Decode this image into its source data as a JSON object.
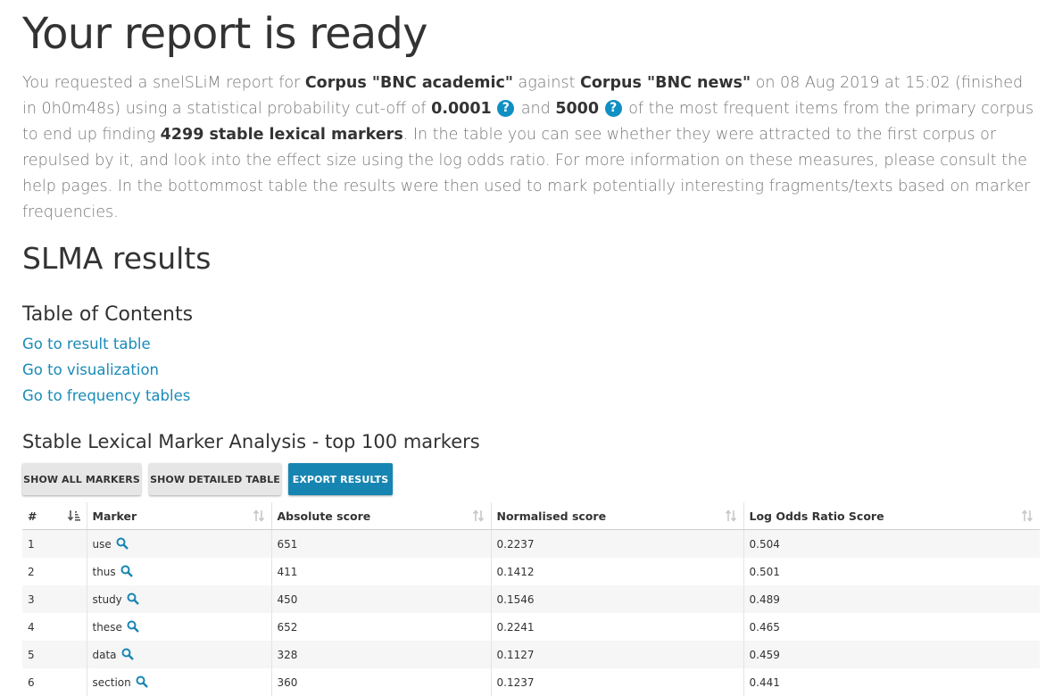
{
  "title": "Your report is ready",
  "intro": {
    "p1": "You requested a snelSLiM report for ",
    "corpus1": "Corpus \"BNC academic\"",
    "p2": " against ",
    "corpus2": "Corpus \"BNC news\"",
    "p3": " on 08 Aug 2019 at 15:02 (finished in 0h0m48s) using a statistical probability cut-off of ",
    "cutoff": "0.0001",
    "p4": " and ",
    "items": "5000",
    "p5": " of the most frequent items from the primary corpus to end up finding ",
    "markers": "4299 stable lexical markers",
    "p6": ". In the table you can see whether they were attracted to the first corpus or repulsed by it, and look into the effect size using the log odds ratio. For more information on these measures, please consult the help pages. In the bottommost table the results were then used to mark potentially interesting fragments/texts based on marker frequencies.",
    "help_glyph": "?"
  },
  "slma_heading": "SLMA results",
  "toc": {
    "heading": "Table of Contents",
    "links": [
      "Go to result table",
      "Go to visualization",
      "Go to frequency tables"
    ]
  },
  "analysis_heading": "Stable Lexical Marker Analysis - top 100 markers",
  "buttons": {
    "show_all": "SHOW ALL MARKERS",
    "show_detailed": "SHOW DETAILED TABLE",
    "export": "EXPORT RESULTS"
  },
  "colors": {
    "accent": "#1785b2",
    "link": "#1a8bb7",
    "help": "#0f8fc2"
  },
  "icons": {
    "sort": "sort-icon",
    "zoom": "magnifier-icon",
    "help": "question-circle-icon"
  },
  "table": {
    "headers": [
      "#",
      "Marker",
      "Absolute score",
      "Normalised score",
      "Log Odds Ratio Score"
    ],
    "rows": [
      [
        "1",
        "use",
        "651",
        "0.2237",
        "0.504"
      ],
      [
        "2",
        "thus",
        "411",
        "0.1412",
        "0.501"
      ],
      [
        "3",
        "study",
        "450",
        "0.1546",
        "0.489"
      ],
      [
        "4",
        "these",
        "652",
        "0.2241",
        "0.465"
      ],
      [
        "5",
        "data",
        "328",
        "0.1127",
        "0.459"
      ],
      [
        "6",
        "section",
        "360",
        "0.1237",
        "0.441"
      ]
    ]
  }
}
